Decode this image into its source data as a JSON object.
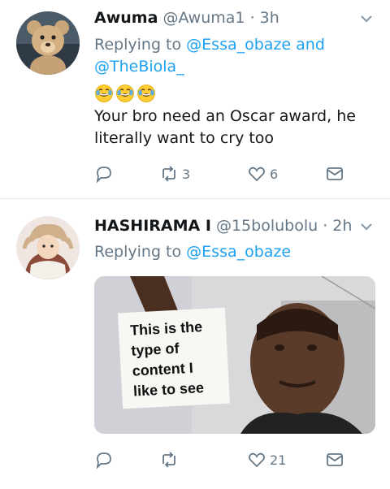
{
  "tweets": [
    {
      "name": "Awuma",
      "handle": "@Awuma1",
      "separator": "·",
      "time": "3h",
      "replying_prefix": "Replying to",
      "mentions": [
        "@Essa_obaze",
        "and",
        "@TheBiola_"
      ],
      "emoji": "face-with-tears-of-joy-icon",
      "body": "Your bro need an Oscar award, he literally want to cry too",
      "actions": {
        "reply": "",
        "retweet": "3",
        "like": "6",
        "dm": ""
      }
    },
    {
      "name": "HASHIRAMA I",
      "handle": "@15bolubolu",
      "separator": "·",
      "time": "2h",
      "replying_prefix": "Replying to",
      "mentions": [
        "@Essa_obaze"
      ],
      "image_sign_lines": [
        "This is the",
        "type of",
        "content I",
        "like to see"
      ],
      "actions": {
        "reply": "",
        "retweet": "",
        "like": "21",
        "dm": ""
      }
    }
  ],
  "colors": {
    "accent": "#1da1f2",
    "muted": "#657786",
    "text": "#14171a",
    "divider": "#e6ecf0"
  }
}
